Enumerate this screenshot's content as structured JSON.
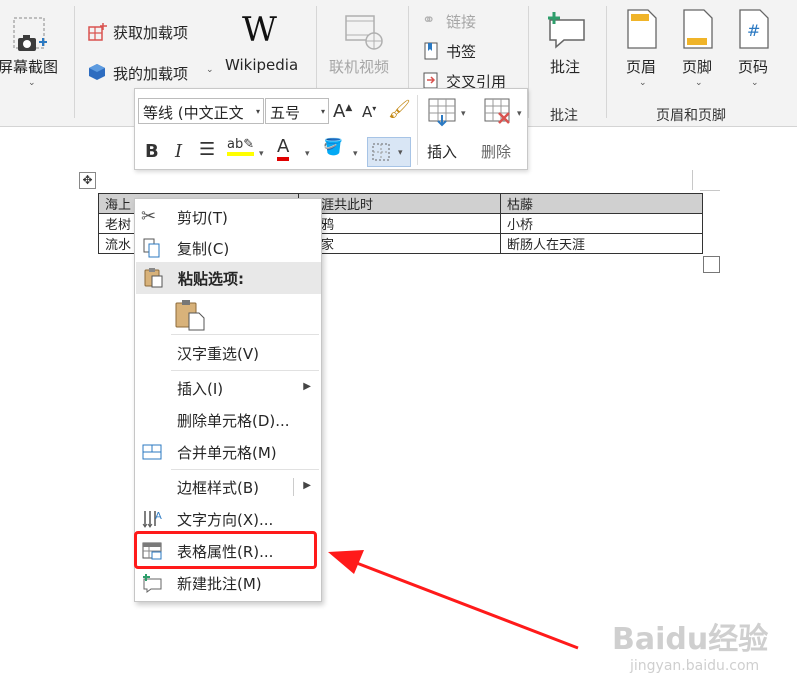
{
  "ribbon": {
    "screenshot_label": "屏幕截图",
    "get_addins_label": "获取加载项",
    "my_addins_label": "我的加载项",
    "wikipedia_label": "Wikipedia",
    "online_video_label": "联机视频",
    "link_label": "链接",
    "bookmark_label": "书签",
    "cross_ref_label": "交叉引用",
    "comment_label": "批注",
    "comment_group_label": "批注",
    "header_label": "页眉",
    "footer_label": "页脚",
    "page_number_label": "页码",
    "header_footer_group_label": "页眉和页脚"
  },
  "mini_toolbar": {
    "font_name": "等线 (中文正文",
    "font_size": "五号",
    "insert_label": "插入",
    "delete_label": "删除"
  },
  "table": {
    "rows": [
      [
        "海上",
        "涯共此时",
        "枯藤"
      ],
      [
        "老树",
        "鸦",
        "小桥"
      ],
      [
        "流水",
        "家",
        "断肠人在天涯"
      ]
    ]
  },
  "context_menu": {
    "cut": "剪切(T)",
    "copy": "复制(C)",
    "paste_options": "粘贴选项:",
    "reconvert": "汉字重选(V)",
    "insert": "插入(I)",
    "delete_cells": "删除单元格(D)...",
    "merge_cells": "合并单元格(M)",
    "border_styles": "边框样式(B)",
    "text_direction": "文字方向(X)...",
    "table_properties": "表格属性(R)...",
    "new_comment": "新建批注(M)"
  },
  "watermark": {
    "brand": "Baidu经验",
    "url": "jingyan.baidu.com"
  },
  "colors": {
    "highlight_red": "#ff1a1a",
    "ribbon_bg": "#f3f3f3",
    "table_header_bg": "#d0d0d0"
  }
}
